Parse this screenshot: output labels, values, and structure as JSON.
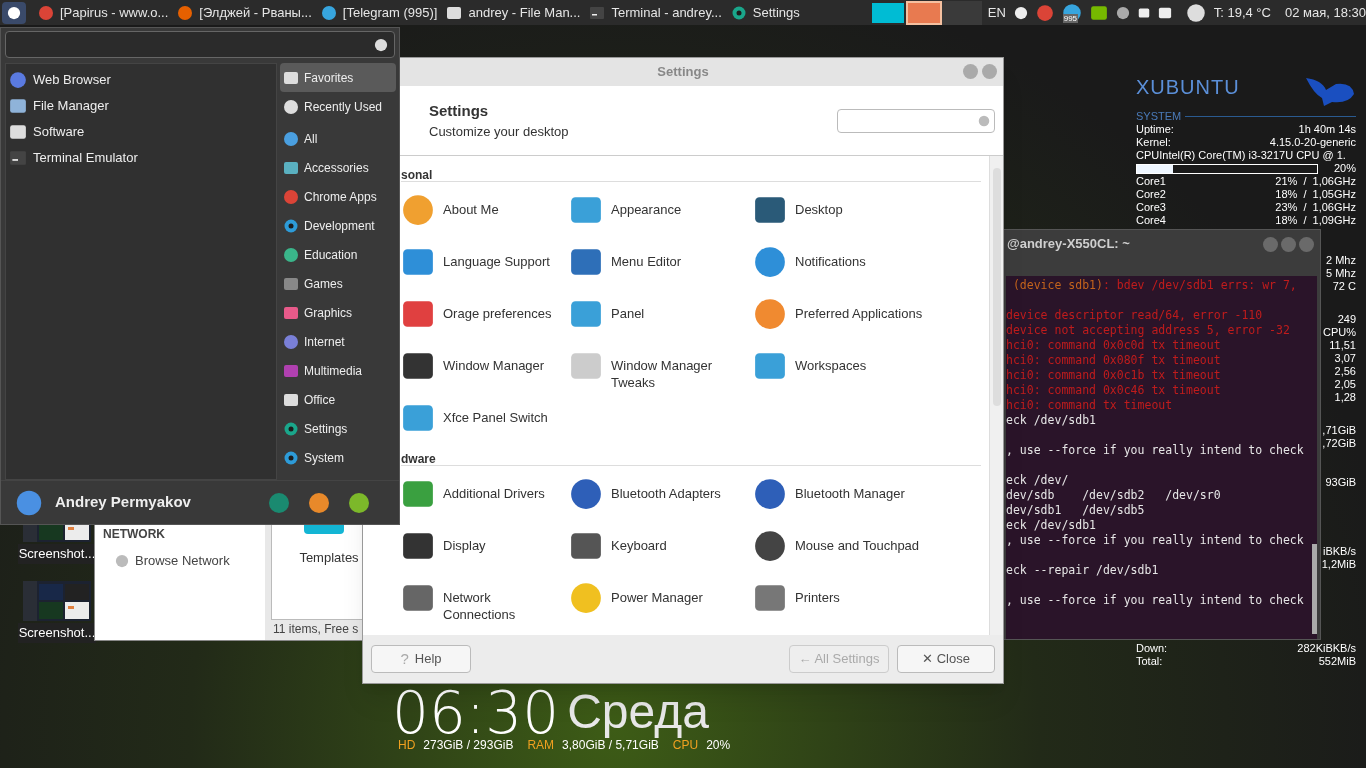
{
  "panel": {
    "tasks": [
      {
        "label": "[Papirus - www.o..."
      },
      {
        "label": "[Элджей - Рваны..."
      },
      {
        "label": "[Telegram (995)]"
      },
      {
        "label": "andrey - File Man..."
      },
      {
        "label": "Terminal - andrey..."
      },
      {
        "label": "Settings"
      }
    ],
    "workspaces": [
      {
        "selected": false
      },
      {
        "selected": true
      }
    ],
    "layout": "EN",
    "telegram_badge": "995",
    "weather": "T: 19,4 °C",
    "clock": "02 мая, 18:30"
  },
  "desktop_icons": [
    {
      "label": "Screenshot..."
    },
    {
      "label": "Screenshot..."
    }
  ],
  "file_manager": {
    "section": "NETWORK",
    "place": "Browse Network",
    "folder": "Templates",
    "status": "11 items, Free s"
  },
  "menu": {
    "apps": [
      "Web Browser",
      "File Manager",
      "Software",
      "Terminal Emulator"
    ],
    "categories": [
      {
        "label": "Favorites",
        "selected": true
      },
      {
        "label": "Recently Used",
        "selected": false
      },
      {
        "label": "All",
        "selected": false
      },
      {
        "label": "Accessories",
        "selected": false
      },
      {
        "label": "Chrome Apps",
        "selected": false
      },
      {
        "label": "Development",
        "selected": false
      },
      {
        "label": "Education",
        "selected": false
      },
      {
        "label": "Games",
        "selected": false
      },
      {
        "label": "Graphics",
        "selected": false
      },
      {
        "label": "Internet",
        "selected": false
      },
      {
        "label": "Multimedia",
        "selected": false
      },
      {
        "label": "Office",
        "selected": false
      },
      {
        "label": "Settings",
        "selected": false
      },
      {
        "label": "System",
        "selected": false
      }
    ],
    "user": "Andrey Permyakov"
  },
  "settings": {
    "title": "Settings",
    "heading": "Settings",
    "subtitle": "Customize your desktop",
    "sections": [
      {
        "heading": "sonal",
        "items": [
          "About Me",
          "Appearance",
          "Desktop",
          "Language Support",
          "Menu Editor",
          "Notifications",
          "Orage preferences",
          "Panel",
          "Preferred Applications",
          "Window Manager",
          "Window Manager Tweaks",
          "Workspaces",
          "Xfce Panel Switch"
        ]
      },
      {
        "heading": "dware",
        "items": [
          "Additional Drivers",
          "Bluetooth Adapters",
          "Bluetooth Manager",
          "Display",
          "Keyboard",
          "Mouse and Touchpad",
          "Network Connections",
          "Power Manager",
          "Printers"
        ]
      }
    ],
    "help": {
      "icon": "?",
      "label": "Help"
    },
    "all_settings": {
      "icon": "←",
      "label": "All Settings",
      "disabled": true
    },
    "close": {
      "icon": "✕",
      "label": "Close"
    }
  },
  "terminal": {
    "title": "@andrey-X550CL: ~",
    "lines": [
      {
        "kind": "text",
        "parts": [
          {
            "text": " (device sdb1)",
            "color": "#c4631c"
          },
          {
            "text": ": bdev /dev/sdb1 errs: wr 7,",
            "color": "#c01c1c"
          }
        ]
      },
      {
        "kind": "blank"
      },
      {
        "kind": "text",
        "parts": [
          {
            "text": "device descriptor read/64, error -110",
            "color": "#c01c1c"
          }
        ]
      },
      {
        "kind": "text",
        "parts": [
          {
            "text": "device not accepting address 5, error -32",
            "color": "#c01c1c"
          }
        ]
      },
      {
        "kind": "text",
        "parts": [
          {
            "text": "hci0: command 0x0c0d tx timeout",
            "color": "#c01c1c"
          }
        ]
      },
      {
        "kind": "text",
        "parts": [
          {
            "text": "hci0: command 0x080f tx timeout",
            "color": "#c01c1c"
          }
        ]
      },
      {
        "kind": "text",
        "parts": [
          {
            "text": "hci0: command 0x0c1b tx timeout",
            "color": "#c01c1c"
          }
        ]
      },
      {
        "kind": "text",
        "parts": [
          {
            "text": "hci0: command 0x0c46 tx timeout",
            "color": "#c01c1c"
          }
        ]
      },
      {
        "kind": "text",
        "parts": [
          {
            "text": "hci0: command tx timeout",
            "color": "#c01c1c"
          }
        ]
      },
      {
        "kind": "text",
        "parts": [
          {
            "text": "eck /dev/sdb1",
            "color": "#e6e6e6"
          }
        ]
      },
      {
        "kind": "blank"
      },
      {
        "kind": "text",
        "parts": [
          {
            "text": ", use --force if you really intend to check",
            "color": "#e6e6e6"
          }
        ]
      },
      {
        "kind": "blank"
      },
      {
        "kind": "text",
        "parts": [
          {
            "text": "eck /dev/",
            "color": "#e6e6e6"
          }
        ]
      },
      {
        "kind": "text",
        "parts": [
          {
            "text": "dev/sdb    /dev/sdb2   /dev/sr0",
            "color": "#e6e6e6"
          }
        ]
      },
      {
        "kind": "text",
        "parts": [
          {
            "text": "dev/sdb1   /dev/sdb5",
            "color": "#e6e6e6"
          }
        ]
      },
      {
        "kind": "text",
        "parts": [
          {
            "text": "eck /dev/sdb1",
            "color": "#e6e6e6"
          }
        ]
      },
      {
        "kind": "text",
        "parts": [
          {
            "text": ", use --force if you really intend to check",
            "color": "#e6e6e6"
          }
        ]
      },
      {
        "kind": "blank"
      },
      {
        "kind": "text",
        "parts": [
          {
            "text": "eck --repair /dev/sdb1",
            "color": "#e6e6e6"
          }
        ]
      },
      {
        "kind": "blank"
      },
      {
        "kind": "text",
        "parts": [
          {
            "text": ", use --force if you really intend to check",
            "color": "#e6e6e6"
          }
        ]
      }
    ]
  },
  "conky": {
    "title": "XUBUNTU",
    "section": "SYSTEM",
    "rows": [
      {
        "label": "Uptime:",
        "value": "1h 40m 14s"
      },
      {
        "label": "Kernel:",
        "value": "4.15.0-20-generic"
      }
    ],
    "cpu_name": "CPUIntel(R) Core(TM) i3-3217U CPU @ 1.",
    "cpu": {
      "level": 0.2,
      "reading": "20%"
    },
    "cores": [
      {
        "label": "Core1",
        "value": "21%  /  1,06GHz"
      },
      {
        "label": "Core2",
        "value": "18%  /  1,05GHz"
      },
      {
        "label": "Core3",
        "value": "23%  /  1,06GHz"
      },
      {
        "label": "Core4",
        "value": "18%  /  1,09GHz"
      }
    ],
    "partial_values": [
      "2 Mhz",
      "5 Mhz",
      "72 C",
      "249",
      "CPU%",
      "11,51",
      "3,07",
      "2,56",
      "2,05",
      "1,28",
      ",71GiB",
      ",72GiB",
      "93GiB",
      "iBKB/s",
      "1,2MiB"
    ],
    "net": [
      {
        "label": "Down:",
        "value": "282KiBKB/s"
      },
      {
        "label": "Total:",
        "value": "552MiB"
      }
    ],
    "time": "06:30",
    "day": "Среда",
    "stats": [
      {
        "label": "HD",
        "value": "273GiB / 293GiB"
      },
      {
        "label": "RAM",
        "value": "3,80GiB / 5,71GiB"
      },
      {
        "label": "CPU",
        "value": "20%"
      }
    ]
  }
}
